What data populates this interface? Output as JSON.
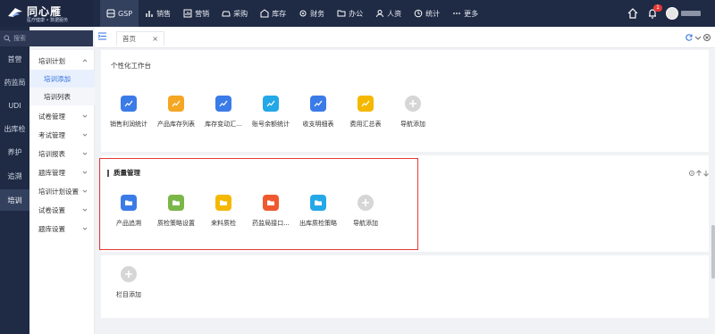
{
  "logo": {
    "name": "同心雁",
    "subtitle": "医疗健康 • 数据服务"
  },
  "nav": [
    {
      "label": "GSP",
      "icon": "database-icon",
      "active": true
    },
    {
      "label": "销售",
      "icon": "bar-chart-icon"
    },
    {
      "label": "营销",
      "icon": "chart-icon"
    },
    {
      "label": "采购",
      "icon": "car-icon"
    },
    {
      "label": "库存",
      "icon": "warehouse-icon"
    },
    {
      "label": "财务",
      "icon": "gear-icon"
    },
    {
      "label": "办公",
      "icon": "folder-icon"
    },
    {
      "label": "人资",
      "icon": "user-icon"
    },
    {
      "label": "统计",
      "icon": "clock-icon"
    },
    {
      "label": "更多",
      "icon": "dots-icon"
    }
  ],
  "top_right": {
    "badge_count": "1"
  },
  "search": {
    "placeholder": "搜索"
  },
  "rail": [
    "首营",
    "药监局",
    "UDI",
    "出库检",
    "养护",
    "追溯",
    "培训"
  ],
  "submenu": [
    {
      "label": "培训计划",
      "type": "open"
    },
    {
      "label": "培训添加",
      "type": "child",
      "selected": true
    },
    {
      "label": "培训列表",
      "type": "child"
    },
    {
      "label": "试卷管理",
      "type": "group"
    },
    {
      "label": "考试管理",
      "type": "group"
    },
    {
      "label": "培训报表",
      "type": "group"
    },
    {
      "label": "题库管理",
      "type": "group"
    },
    {
      "label": "培训计划设置",
      "type": "group"
    },
    {
      "label": "试卷设置",
      "type": "group"
    },
    {
      "label": "题库设置",
      "type": "group"
    }
  ],
  "tabs": {
    "home": "首页",
    "close": "×"
  },
  "workspace": {
    "title": "个性化工作台",
    "stats_apps": [
      {
        "label": "销售利润统计",
        "color": "#3b7be8"
      },
      {
        "label": "产品库存列表",
        "color": "#f5a623"
      },
      {
        "label": "库存变动汇...",
        "color": "#3b7be8"
      },
      {
        "label": "账号余额统计",
        "color": "#25a8e8"
      },
      {
        "label": "收支明细表",
        "color": "#3b7be8"
      },
      {
        "label": "费用汇总表",
        "color": "#f5b800"
      },
      {
        "label": "导航添加",
        "color": "#d6d6d6"
      }
    ],
    "quality": {
      "title": "质量管理",
      "apps": [
        {
          "label": "产品追溯",
          "color": "#3b7be8"
        },
        {
          "label": "质检策略设置",
          "color": "#7ab648"
        },
        {
          "label": "来料质检",
          "color": "#f5b800"
        },
        {
          "label": "药监局接口...",
          "color": "#f0592f"
        },
        {
          "label": "出库质检策略",
          "color": "#25a8e8"
        },
        {
          "label": "导航添加",
          "color": "#d6d6d6"
        }
      ]
    },
    "add_column": "栏目添加"
  }
}
